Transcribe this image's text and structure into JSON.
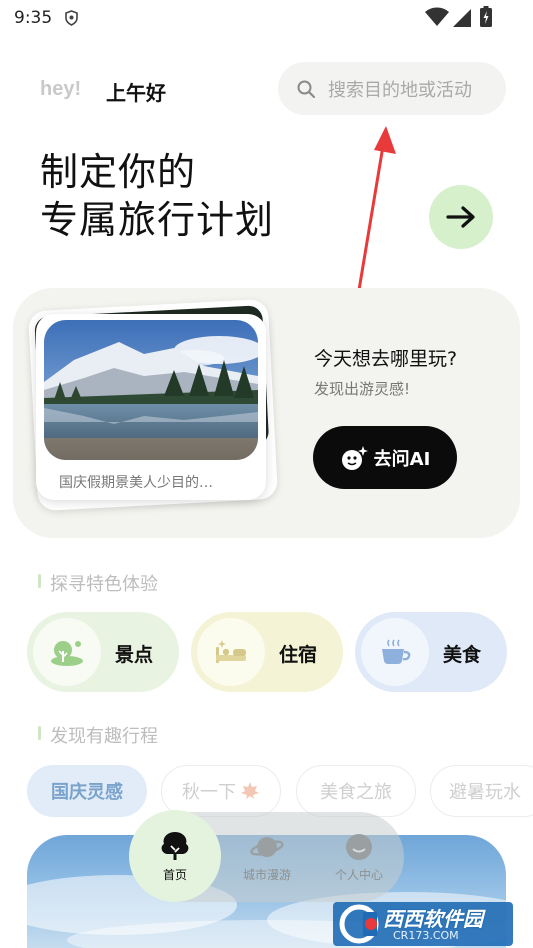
{
  "status_bar": {
    "time": "9:35"
  },
  "header": {
    "greeting_hey": "hey!",
    "greeting": "上午好",
    "search_placeholder": "搜索目的地或活动"
  },
  "hero": {
    "line1": "制定你的",
    "line2": "专属旅行计划"
  },
  "ai_card": {
    "photo_caption": "国庆假期景美人少目的…",
    "question": "今天想去哪里玩?",
    "subtitle": "发现出游灵感!",
    "ask_button": "去问AI"
  },
  "experiences": {
    "title": "探寻特色体验",
    "items": [
      {
        "label": "景点",
        "icon": "tree-icon"
      },
      {
        "label": "住宿",
        "icon": "bed-icon"
      },
      {
        "label": "美食",
        "icon": "cup-icon"
      }
    ]
  },
  "trips": {
    "title": "发现有趣行程",
    "tags": [
      "国庆灵感",
      "秋一下",
      "美食之旅",
      "避暑玩水"
    ],
    "selected_tag": "国庆灵感"
  },
  "bottom_nav": {
    "items": [
      "首页",
      "城市漫游",
      "个人中心"
    ],
    "active": "首页"
  },
  "watermark": {
    "brand": "西西软件园",
    "site": "CR173.COM"
  },
  "colors": {
    "accent_green": "#d6f0cc",
    "annotation_red": "#e83a3a",
    "tag_blue": "#e2ecf8"
  }
}
